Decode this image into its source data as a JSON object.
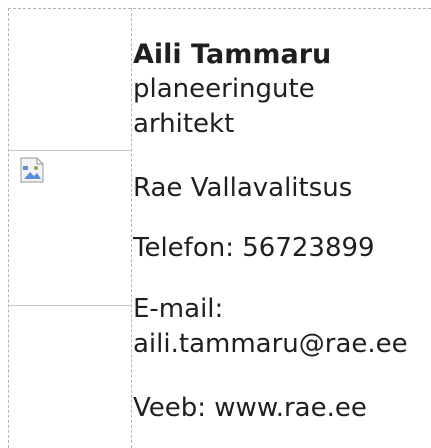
{
  "signature": {
    "name": "Aili Tammaru",
    "title_line1": "planeeringute",
    "title_line2": "arhitekt",
    "organization": "Rae Vallavalitsus",
    "phone_label": "Telefon:",
    "phone_value": "56723899",
    "email_label": "E-mail:",
    "email_value": "aili.tammaru@rae.ee",
    "web_label": "Veeb:",
    "web_value": "www.rae.ee"
  },
  "image": {
    "icon": "broken-image-icon"
  },
  "colors": {
    "text": "#1f1f1f",
    "guide": "#b5b5b5"
  }
}
